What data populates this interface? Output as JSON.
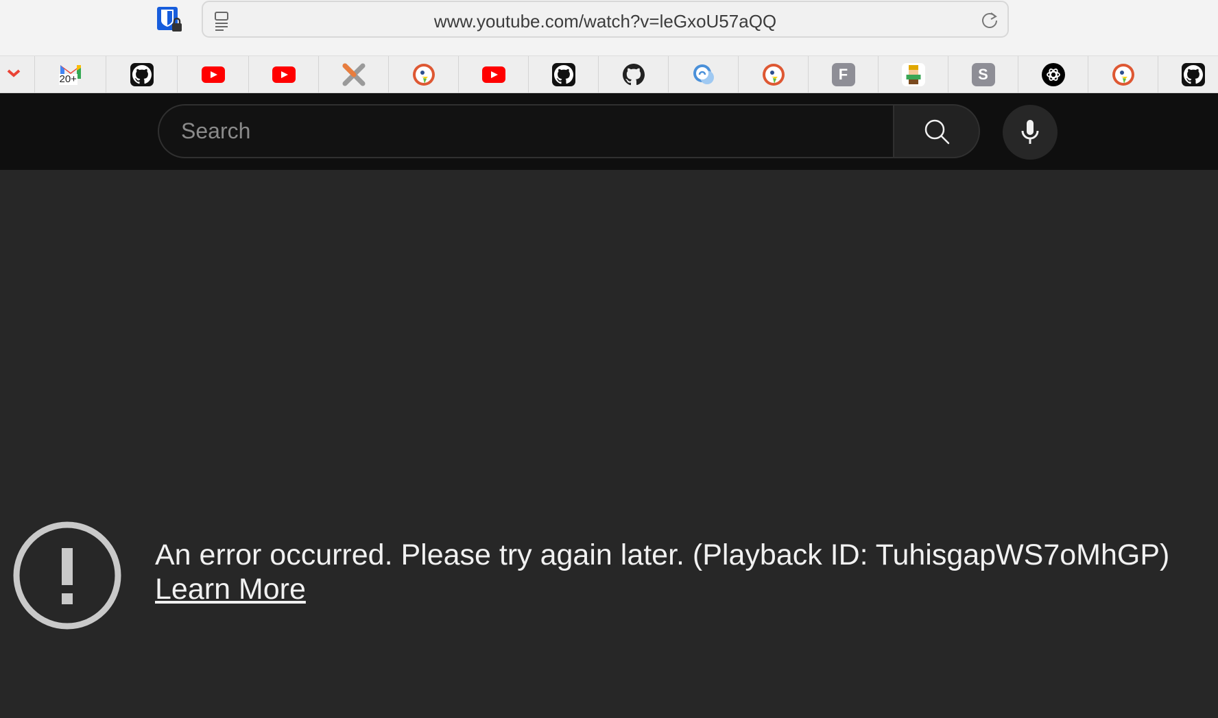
{
  "browser": {
    "url": "www.youtube.com/watch?v=leGxoU57aQQ"
  },
  "tabs": [
    {
      "icon": "gmail-icon",
      "badge": "20+"
    },
    {
      "icon": "github-icon"
    },
    {
      "icon": "youtube-icon"
    },
    {
      "icon": "youtube-icon"
    },
    {
      "icon": "x-app-icon"
    },
    {
      "icon": "duckduckgo-icon"
    },
    {
      "icon": "youtube-icon"
    },
    {
      "icon": "github-icon"
    },
    {
      "icon": "github-icon"
    },
    {
      "icon": "chat-bubble-icon"
    },
    {
      "icon": "duckduckgo-icon"
    },
    {
      "icon": "letter-f-icon",
      "letter": "F"
    },
    {
      "icon": "pixel-character-icon"
    },
    {
      "icon": "letter-s-icon",
      "letter": "S"
    },
    {
      "icon": "openai-icon"
    },
    {
      "icon": "duckduckgo-icon"
    },
    {
      "icon": "github-icon"
    }
  ],
  "youtube": {
    "search_placeholder": "Search"
  },
  "error": {
    "message": "An error occurred. Please try again later. (Playback ID: TuhisgapWS7oMhGP)",
    "link_label": "Learn More"
  },
  "colors": {
    "page_bg": "#272727",
    "header_bg": "#0f0f0f",
    "youtube_red": "#ff0000",
    "text": "#f1f1f1"
  }
}
